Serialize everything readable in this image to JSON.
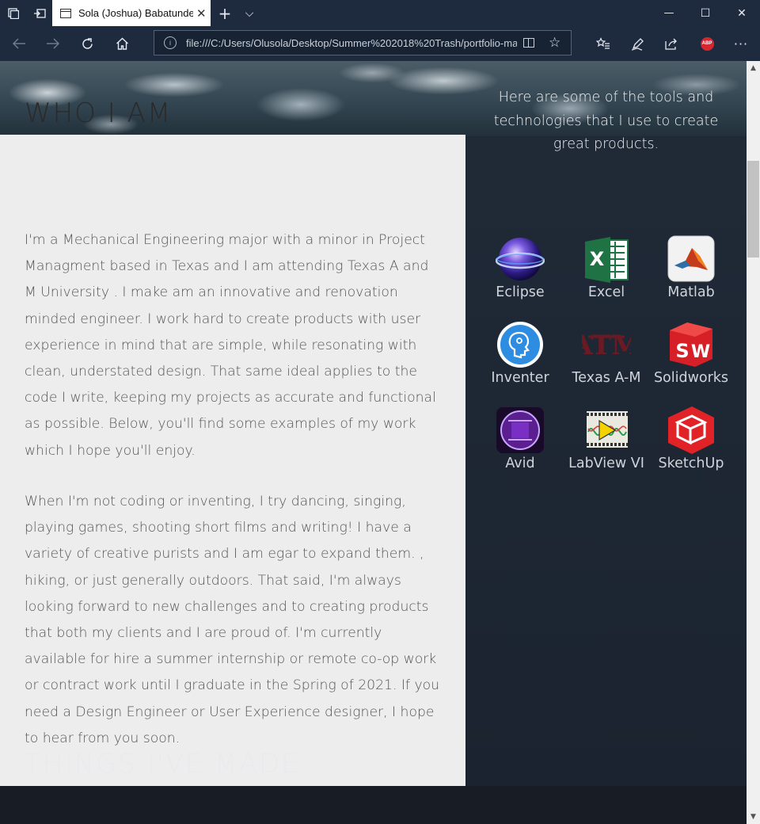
{
  "browser": {
    "tab_title": "Sola (Joshua) Babatunde",
    "tab_close": "✕",
    "new_tab": "+",
    "tabs_dropdown": "⌵",
    "url": "file:///C:/Users/Olusola/Desktop/Summer%202018%20Trash/portfolio-ma",
    "window_minimize": "—",
    "window_maximize": "☐",
    "window_close": "✕",
    "abp_label": "ABP"
  },
  "about": {
    "heading": "WHO I AM",
    "paragraph_1": "I'm a Mechanical Engineering major with a minor in Project Managment based in Texas and I am attending Texas A and M University . I make am an innovative and renovation minded engineer. I work hard to create products with user experience in mind that are simple, while resonating with clean, understated design. That same ideal applies to the code I write, keeping my projects as accurate and functional as possible. Below, you'll find some examples of my work which I hope you'll enjoy.",
    "paragraph_2": "When I'm not coding or inventing, I try dancing, singing, playing games, shooting short films and writing! I have a variety of creative purists and I am egar to expand them. , hiking, or just generally outdoors. That said, I'm always looking forward to new challenges and to creating products that both my clients and I are proud of. I'm currently available for hire a summer internship or remote co-op work or contract work until I graduate in the Spring of 2021. If you need a Design Engineer or User Experience designer, I hope to hear from you soon."
  },
  "tools": {
    "intro": "Here are some of the tools and technologies that I use to create great products.",
    "items": [
      {
        "label": "Eclipse",
        "icon": "eclipse-icon"
      },
      {
        "label": "Excel",
        "icon": "excel-icon"
      },
      {
        "label": "Matlab",
        "icon": "matlab-icon"
      },
      {
        "label": "Inventer",
        "icon": "inventor-icon"
      },
      {
        "label": "Texas A-M",
        "icon": "texas-am-icon"
      },
      {
        "label": "Solidworks",
        "icon": "solidworks-icon"
      },
      {
        "label": "Avid",
        "icon": "avid-icon"
      },
      {
        "label": "LabView VI",
        "icon": "labview-icon"
      },
      {
        "label": "SketchUp",
        "icon": "sketchup-icon"
      }
    ]
  },
  "things": {
    "heading": "THINGS I'VE MADE"
  },
  "colors": {
    "browser_chrome": "#1e2b3f",
    "about_background": "#ededed",
    "dark_panel": "#1b2330"
  }
}
